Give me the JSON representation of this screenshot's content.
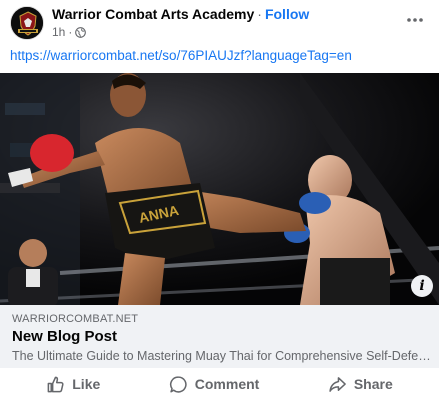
{
  "header": {
    "page_name": "Warrior Combat Arts Academy",
    "separator": "·",
    "follow_label": "Follow",
    "time": "1h",
    "time_sep": "·"
  },
  "post": {
    "link_text": "https://warriorcombat.net/so/76PIAUJzf?languageTag=en"
  },
  "link_preview": {
    "domain": "WARRIORCOMBAT.NET",
    "title": "New Blog Post",
    "description": "The Ultimate Guide to Mastering Muay Thai for Comprehensive Self-Defense",
    "info_glyph": "i"
  },
  "actions": {
    "like": "Like",
    "comment": "Comment",
    "share": "Share"
  },
  "icons": {
    "globe": "globe-icon",
    "more": "more-horizontal-icon",
    "like": "thumbs-up-icon",
    "comment": "comment-bubble-icon",
    "share": "share-arrow-icon",
    "info": "info-icon"
  },
  "colors": {
    "accent": "#1877f2",
    "secondary_text": "#65676b",
    "preview_bg": "#f0f2f5",
    "glove_red": "#d8262e",
    "glove_blue": "#2a5fb5"
  }
}
